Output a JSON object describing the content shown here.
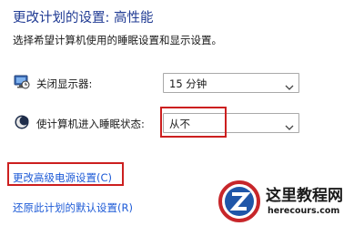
{
  "header": {
    "title": "更改计划的设置: 高性能",
    "subtitle": "选择希望计算机使用的睡眠设置和显示设置。"
  },
  "settings": [
    {
      "icon": "monitor-clock-icon",
      "label": "关闭显示器:",
      "value": "15 分钟"
    },
    {
      "icon": "moon-sleep-icon",
      "label": "使计算机进入睡眠状态:",
      "value": "从不"
    }
  ],
  "links": {
    "advanced": "更改高级电源设置(C)",
    "restore": "还原此计划的默认设置(R)"
  },
  "watermark": {
    "name": "这里教程网",
    "url": "herecours.com",
    "logo_icon": "z-logo-icon"
  },
  "colors": {
    "title": "#1f3a93",
    "link": "#1e5bd7",
    "highlight": "#cc1f1f"
  }
}
